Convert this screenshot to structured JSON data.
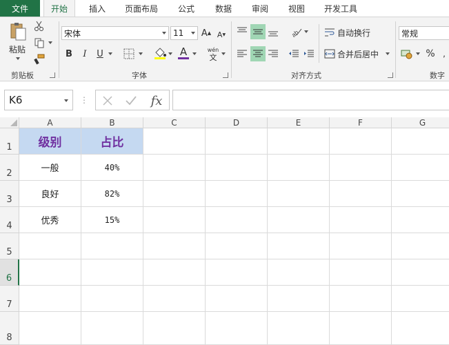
{
  "ribbon_tabs": {
    "file": "文件",
    "home": "开始",
    "insert": "插入",
    "page_layout": "页面布局",
    "formulas": "公式",
    "data": "数据",
    "review": "审阅",
    "view": "视图",
    "developer": "开发工具"
  },
  "clipboard": {
    "paste_label": "粘贴",
    "group_label": "剪贴板"
  },
  "font": {
    "name": "宋体",
    "size": "11",
    "bold": "B",
    "italic": "I",
    "underline": "U",
    "font_color_letter": "A",
    "phonetic_top": "wén",
    "phonetic_bottom": "文",
    "group_label": "字体"
  },
  "alignment": {
    "wrap_text": "自动换行",
    "merge_center": "合并后居中",
    "group_label": "对齐方式"
  },
  "number": {
    "format": "常规",
    "percent": "%",
    "group_label": "数字"
  },
  "formula_bar": {
    "name_box": "K6",
    "fx": "fx",
    "value": ""
  },
  "columns": [
    "A",
    "B",
    "C",
    "D",
    "E",
    "F",
    "G"
  ],
  "rows": [
    "1",
    "2",
    "3",
    "4",
    "5",
    "6",
    "7",
    "8"
  ],
  "table": {
    "header": {
      "level": "级别",
      "ratio": "占比"
    },
    "rows": [
      {
        "level": "一般",
        "ratio": "40%"
      },
      {
        "level": "良好",
        "ratio": "82%"
      },
      {
        "level": "优秀",
        "ratio": "15%"
      }
    ]
  },
  "colors": {
    "accent": "#217346",
    "header_fill": "#c5d9f1",
    "header_text": "#7030a0"
  },
  "selected_row": "6"
}
